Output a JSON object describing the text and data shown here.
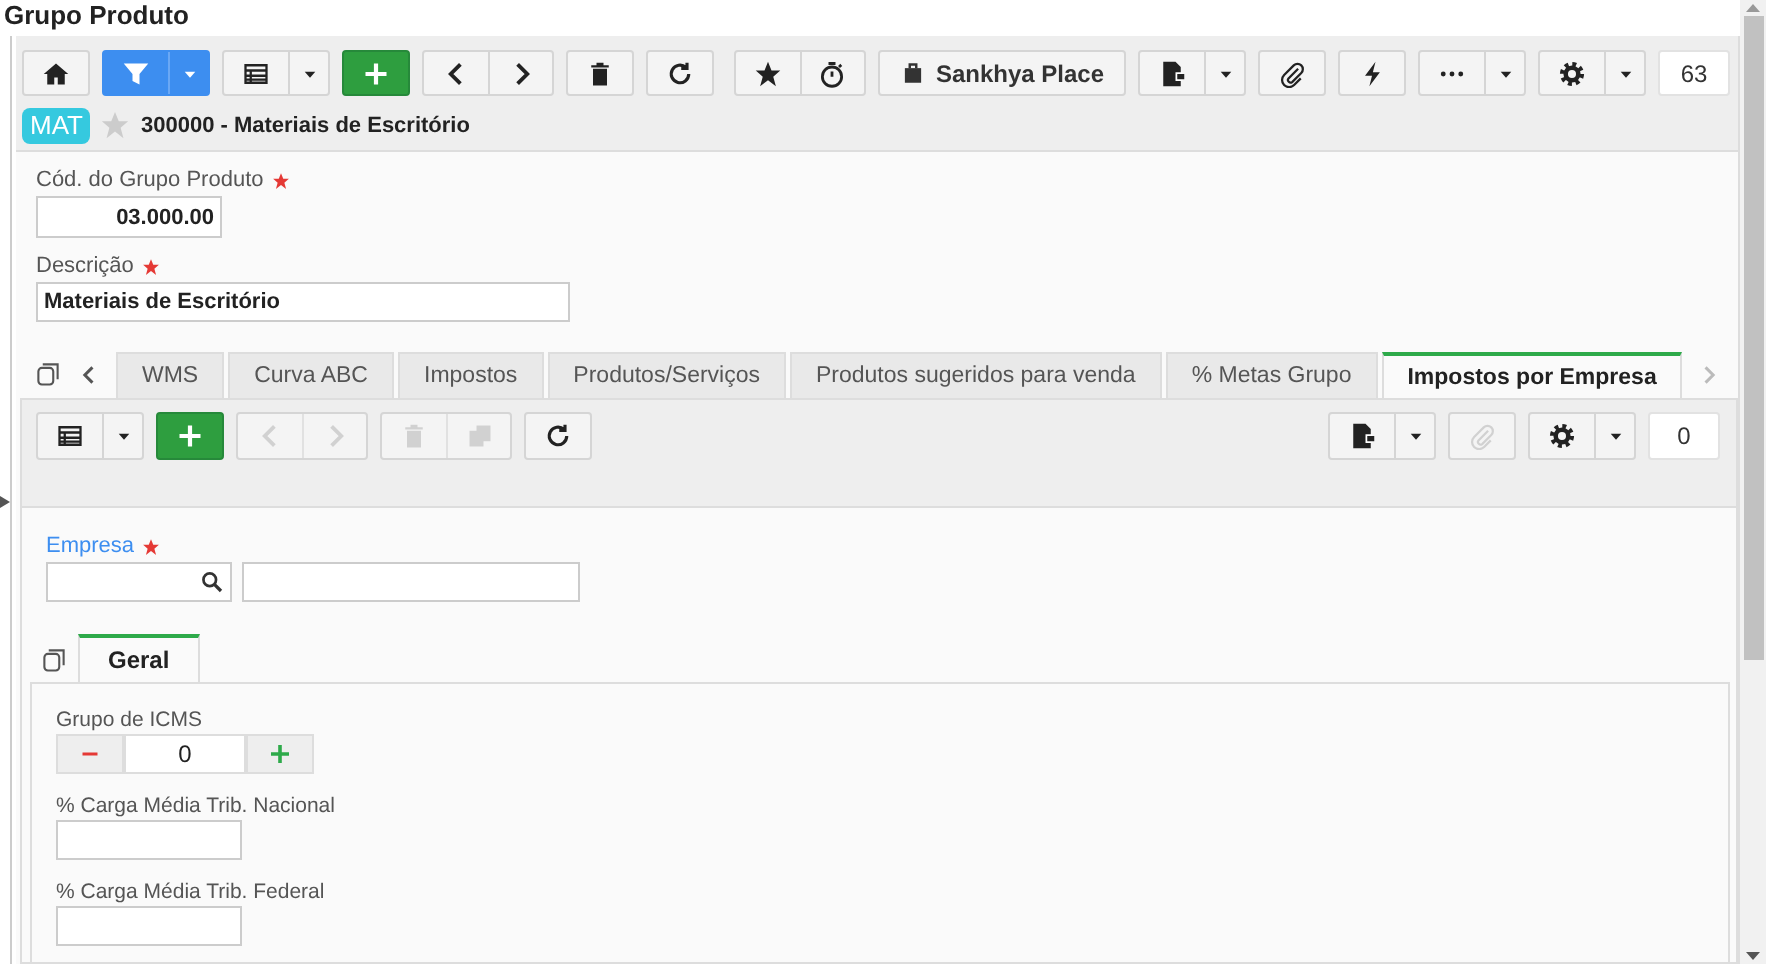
{
  "window": {
    "title": "Grupo Produto"
  },
  "toolbar": {
    "left": [
      {
        "buttons": [
          {
            "kind": "icon",
            "disabled": false
          }
        ]
      },
      {
        "buttons": [
          {
            "kind": "icon",
            "disabled": false
          },
          {
            "kind": "caret",
            "disabled": false
          }
        ]
      },
      {
        "buttons": [
          {
            "kind": "icon",
            "disabled": false
          },
          {
            "kind": "caret",
            "disabled": false
          }
        ]
      },
      {
        "buttons": [
          {
            "kind": "icon",
            "disabled": false
          }
        ]
      },
      {
        "buttons": [
          {
            "kind": "icon",
            "disabled": false
          },
          {
            "kind": "icon",
            "disabled": false
          }
        ]
      },
      {
        "buttons": [
          {
            "kind": "icon",
            "disabled": false
          }
        ]
      },
      {
        "buttons": [
          {
            "kind": "icon",
            "disabled": false
          }
        ]
      }
    ],
    "right": [
      {
        "buttons": [
          {
            "kind": "icon",
            "disabled": false
          },
          {
            "kind": "icon",
            "disabled": false
          }
        ]
      },
      {
        "buttons": [
          {
            "kind": "text",
            "label": "Sankhya Place",
            "disabled": false
          }
        ]
      },
      {
        "buttons": [
          {
            "kind": "icon",
            "disabled": false
          },
          {
            "kind": "caret",
            "disabled": false
          }
        ]
      },
      {
        "buttons": [
          {
            "kind": "icon",
            "disabled": false
          }
        ]
      },
      {
        "buttons": [
          {
            "kind": "icon",
            "disabled": false
          }
        ]
      },
      {
        "buttons": [
          {
            "kind": "icon",
            "disabled": false
          },
          {
            "kind": "caret",
            "disabled": false
          }
        ]
      },
      {
        "buttons": [
          {
            "kind": "icon",
            "disabled": false
          },
          {
            "kind": "caret",
            "disabled": false
          }
        ]
      }
    ],
    "count": "63"
  },
  "record": {
    "badge": "MAT",
    "favorite": false,
    "title": "300000 - Materiais de Escritório"
  },
  "fields": [
    {
      "kind": "code",
      "label": "Cód. do Grupo Produto",
      "required": true,
      "value": "03.000.00"
    },
    {
      "kind": "text",
      "label": "Descrição",
      "required": true,
      "value": "Materiais de Escritório"
    }
  ],
  "tabs": [
    {
      "label": "WMS",
      "selected": false
    },
    {
      "label": "Curva ABC",
      "selected": false
    },
    {
      "label": "Impostos",
      "selected": false
    },
    {
      "label": "Produtos/Serviços",
      "selected": false
    },
    {
      "label": "Produtos sugeridos para venda",
      "selected": false
    },
    {
      "label": "% Metas Grupo",
      "selected": false
    },
    {
      "label": "Impostos por Empresa",
      "selected": true
    }
  ],
  "detail": {
    "toolbar": {
      "left": [
        {
          "buttons": [
            {
              "kind": "icon",
              "disabled": false
            },
            {
              "kind": "caret",
              "disabled": false
            }
          ]
        },
        {
          "buttons": [
            {
              "kind": "icon",
              "disabled": false
            }
          ]
        },
        {
          "buttons": [
            {
              "kind": "icon",
              "disabled": true
            },
            {
              "kind": "icon",
              "disabled": true
            }
          ]
        },
        {
          "buttons": [
            {
              "kind": "icon",
              "disabled": true
            },
            {
              "kind": "icon",
              "disabled": true
            }
          ]
        },
        {
          "buttons": [
            {
              "kind": "icon",
              "disabled": false
            }
          ]
        }
      ],
      "right": [
        {
          "buttons": [
            {
              "kind": "icon",
              "disabled": false
            },
            {
              "kind": "caret",
              "disabled": false
            }
          ]
        },
        {
          "buttons": [
            {
              "kind": "icon",
              "disabled": true
            }
          ]
        },
        {
          "buttons": [
            {
              "kind": "icon",
              "disabled": false
            },
            {
              "kind": "caret",
              "disabled": false
            }
          ]
        }
      ],
      "count": "0"
    },
    "lookup": {
      "label": "Empresa",
      "required": true,
      "focused": true
    },
    "subtabs": [
      {
        "label": "Geral",
        "selected": true
      }
    ],
    "form": [
      {
        "kind": "stepper",
        "label": "Grupo de ICMS",
        "value": "0"
      },
      {
        "kind": "input",
        "label": "% Carga Média Trib. Nacional"
      },
      {
        "kind": "input",
        "label": "% Carga Média Trib. Federal"
      }
    ]
  }
}
